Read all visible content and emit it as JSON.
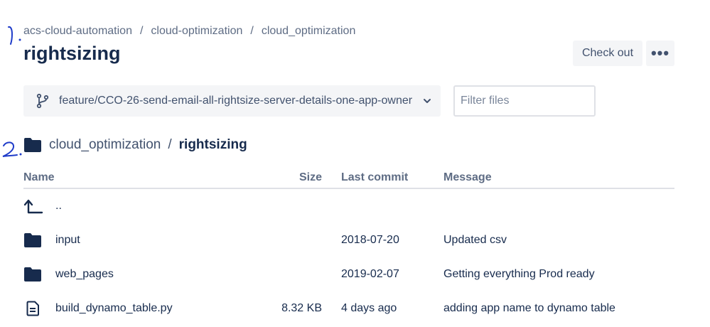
{
  "breadcrumb": {
    "items": [
      "acs-cloud-automation",
      "cloud-optimization",
      "cloud_optimization"
    ],
    "separator": "/"
  },
  "page_title": "rightsizing",
  "actions": {
    "checkout_label": "Check out",
    "more_label": "•••"
  },
  "branch_selector": {
    "label": "feature/CCO-26-send-email-all-rightsize-server-details-one-app-owner"
  },
  "filter": {
    "placeholder": "Filter files",
    "value": ""
  },
  "path": {
    "parent": "cloud_optimization",
    "separator": "/",
    "current": "rightsizing"
  },
  "table": {
    "columns": {
      "name": "Name",
      "size": "Size",
      "last_commit": "Last commit",
      "message": "Message"
    },
    "parent_link": "..",
    "rows": [
      {
        "type": "folder",
        "name": "input",
        "size": "",
        "last_commit": "2018-07-20",
        "message": "Updated csv"
      },
      {
        "type": "folder",
        "name": "web_pages",
        "size": "",
        "last_commit": "2019-02-07",
        "message": "Getting everything Prod ready"
      },
      {
        "type": "file",
        "name": "build_dynamo_table.py",
        "size": "8.32 KB",
        "last_commit": "4 days ago",
        "message": "adding app name to dynamo table"
      }
    ]
  },
  "annotations": {
    "mark_1": "1.",
    "mark_2": "2."
  },
  "icons": {
    "branch": "branch-icon",
    "chevron": "chevron-down-icon",
    "folder": "folder-icon",
    "parent": "parent-directory-icon",
    "file": "file-icon"
  },
  "colors": {
    "text_primary": "#172b4d",
    "text_secondary": "#5e6c84",
    "button_bg": "#f4f5f7",
    "border": "#dfe1e6",
    "annotation_ink": "#1f3cc9"
  }
}
